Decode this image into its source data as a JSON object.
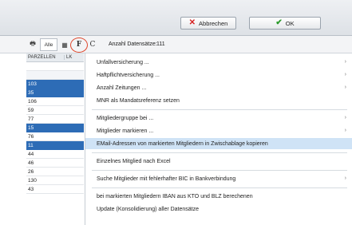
{
  "buttons": {
    "cancel": "Abbrechen",
    "ok": "OK"
  },
  "toolbar": {
    "all_label": "Alle",
    "f_label": "F",
    "c_label": "C",
    "count_label": "Anzahl Datensätze:",
    "count_value": "111"
  },
  "grid": {
    "col1": "PARZELLEN",
    "col2": "LK",
    "rows": [
      "",
      "",
      "103",
      "35",
      "106",
      "59",
      "77",
      "15",
      "76",
      "11",
      "44",
      "46",
      "26",
      "130",
      "43"
    ]
  },
  "menu": [
    "Unfallversicherung ...",
    "Haftpflichtversicherung ...",
    "Anzahl Zeitungen ...",
    "MNR als Mandatsreferenz setzen",
    "Mitgliedergruppe bei ...",
    "Mitglieder markieren ...",
    "EMail-Adressen von markierten Mitgliedern in Zwischablage kopieren",
    "Einzelnes Mitglied nach Excel",
    "Suche Mitglieder mit fehlerhafter BIC in Bankverbindung",
    "bei markierten Mitgliedern IBAN aus KTO und BLZ berechenen",
    "Update (Konsolidierung) aller Datensätze"
  ],
  "submenu_arrow": "›"
}
